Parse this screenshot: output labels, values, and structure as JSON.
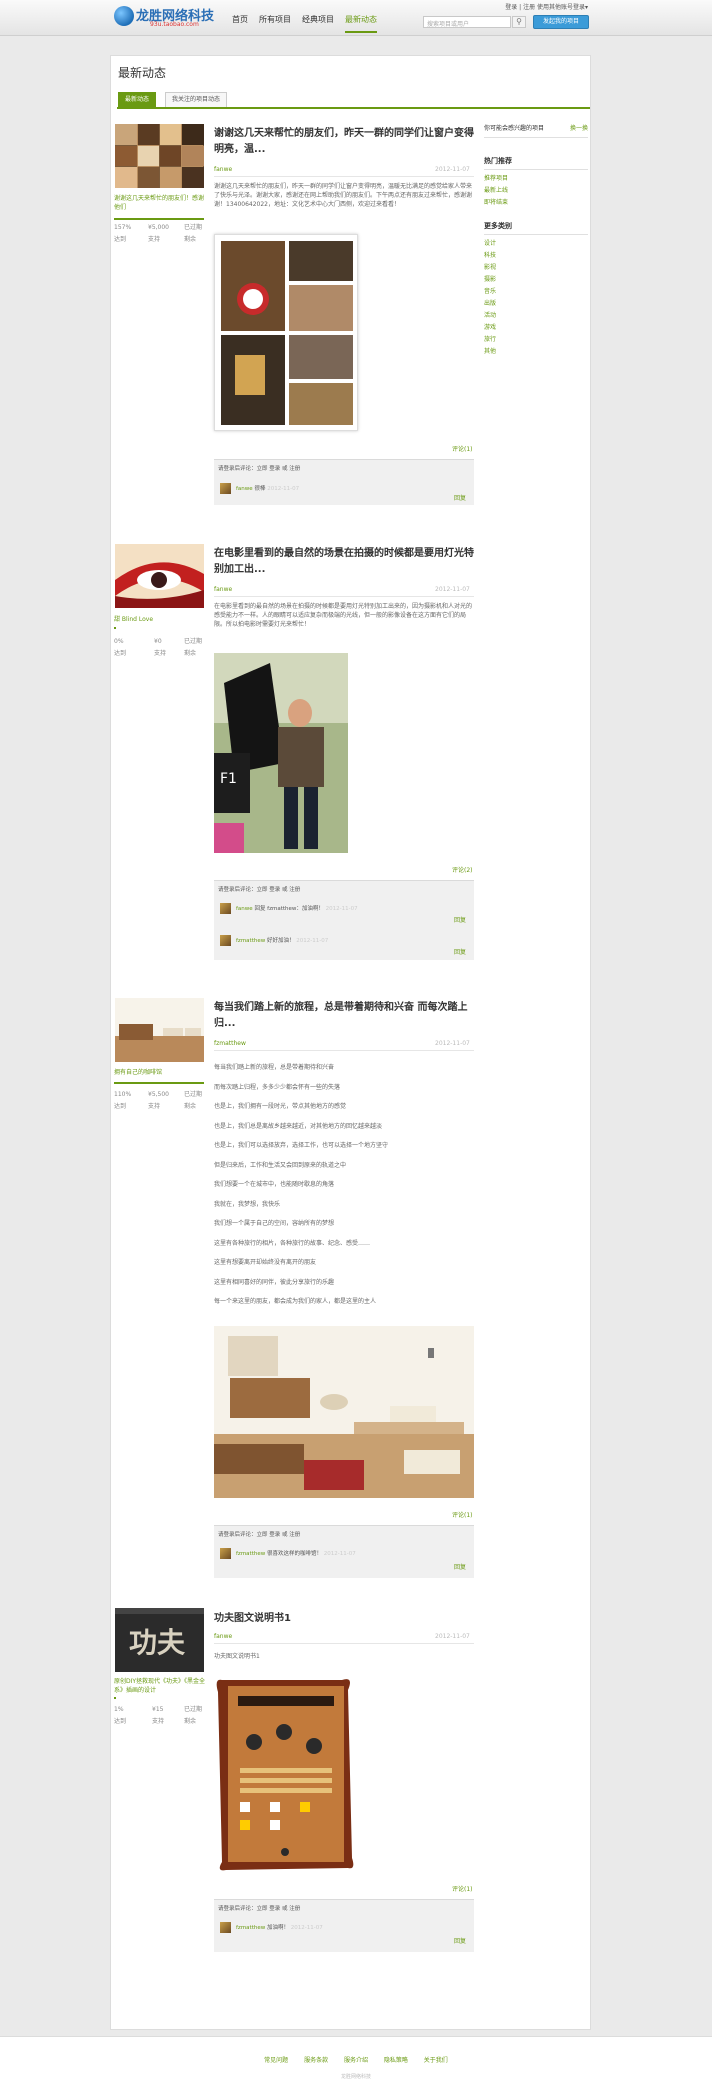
{
  "header": {
    "logo_title": "龙胜网络科技",
    "logo_sub": "93u.taobao.com",
    "nav": [
      "首页",
      "所有项目",
      "经典项目",
      "最新动态"
    ],
    "top_links": "登录 | 注册  使用其他账号登录▾",
    "search_placeholder": "搜索项目或用户",
    "create_button": "发起我的项目"
  },
  "page": {
    "title": "最新动态",
    "tabs": [
      "最新动态",
      "我关注的项目动态"
    ]
  },
  "sidebar": {
    "promo": "你可能会感兴趣的项目",
    "promo_link": "换一换",
    "hot_title": "热门推荐",
    "hot": [
      "推荐项目",
      "最新上线",
      "即将结束"
    ],
    "more_title": "更多类别",
    "more": [
      "设计",
      "科技",
      "影视",
      "摄影",
      "音乐",
      "出版",
      "活动",
      "游戏",
      "旅行",
      "其他"
    ]
  },
  "posts": [
    {
      "proj_caption": "谢谢这几天来帮忙的朋友们！感谢他们",
      "stats": [
        "157%",
        "¥5,000",
        "已过期"
      ],
      "stats_labels": [
        "达到",
        "支持",
        "剩余"
      ],
      "title": "谢谢这几天来帮忙的朋友们，昨天一群的同学们让窗户变得明亮，温...",
      "author": "fanwe",
      "date": "2012-11-07",
      "body": "谢谢这几天来帮忙的朋友们，昨天一群的同学们让窗户变得明亮，温暖无比满足的感觉给家人带来了快乐与光泽。谢谢大家，感谢还在网上帮助我们的朋友们。下午两点还有朋友过来帮忙，感谢谢谢！13400642022，地址：文化艺术中心大门西侧，欢迎过来看看！",
      "comments_link": "评论(1)",
      "login_text": "请登录后评论：立即 登录 或 注册",
      "comments": [
        {
          "user": "fanwe",
          "text": "很棒",
          "time": "2012-11-07"
        }
      ],
      "reply": "回复"
    },
    {
      "proj_caption": "甜 Blind Love",
      "stats": [
        "0%",
        "¥0",
        "已过期"
      ],
      "stats_labels": [
        "达到",
        "支持",
        "剩余"
      ],
      "title": "在电影里看到的最自然的场景在拍摄的时候都是要用灯光特别加工出...",
      "author": "fanwe",
      "date": "2012-11-07",
      "body": "在电影里看到的最自然的场景在拍摄的时候都是要用灯光特别加工出来的，因为摄影机和人对光的感受能力不一样。人的眼睛可以适应复杂而极端的光线，但一般的影像设备在这方面有它们的局限。所以拍电影时需要灯光来帮忙！",
      "comments_link": "评论(2)",
      "login_text": "请登录后评论：立即 登录 或 注册",
      "comments": [
        {
          "user": "fanwe",
          "text": "回复 fzmatthew：加油啊！",
          "time": "2012-11-07"
        },
        {
          "user": "fzmatthew",
          "text": "好好加油！",
          "time": "2012-11-07"
        }
      ],
      "reply": "回复"
    },
    {
      "proj_caption": "拥有自己的咖啡馆",
      "stats": [
        "110%",
        "¥5,500",
        "已过期"
      ],
      "stats_labels": [
        "达到",
        "支持",
        "剩余"
      ],
      "title": "每当我们踏上新的旅程，总是带着期待和兴奋 而每次踏上归...",
      "author": "fzmatthew",
      "date": "2012-11-07",
      "lines": [
        "每当我们踏上新的旅程，总是带着期待和兴奋",
        "而每次踏上归程，多多少少都会怀有一些的失落",
        "也是上，我们拥有一段时光，带点其他地方的感觉",
        "也是上，我们总是离故乡越来越近，对其他地方的回忆越来越淡",
        "也是上，我们可以选择放弃，选择工作，也可以选择一个地方坚守",
        "但是归来后，工作和生活又会回到原来的轨道之中",
        "我们想要一个在城市中，也能随时歇息的角落",
        "我就在，我梦想，我快乐",
        "",
        "我们想一个属于自己的空间，容纳所有的梦想",
        "这里有各种旅行的相片，各种旅行的故事、纪念、感受……",
        "这里有想要离开却始终没有离开的朋友",
        "这里有相同喜好的同伴，彼此分享旅行的乐趣",
        "每一个来这里的朋友，都会成为我们的家人，都是这里的主人"
      ],
      "comments_link": "评论(1)",
      "login_text": "请登录后评论：立即 登录 或 注册",
      "comments": [
        {
          "user": "fzmatthew",
          "text": "很喜欢这样的咖啡馆！",
          "time": "2012-11-07"
        }
      ],
      "reply": "回复"
    },
    {
      "proj_caption": "原创DIY拯救现代《功夫》《黑金全系》插画的设计",
      "stats": [
        "1%",
        "¥15",
        "已过期"
      ],
      "stats_labels": [
        "达到",
        "支持",
        "剩余"
      ],
      "title": "功夫图文说明书1",
      "author": "fanwe",
      "date": "2012-11-07",
      "body": "功夫图文说明书1",
      "comments_link": "评论(1)",
      "login_text": "请登录后评论：立即 登录 或 注册",
      "comments": [
        {
          "user": "fzmatthew",
          "text": "加油啊！",
          "time": "2012-11-07"
        }
      ],
      "reply": "回复"
    }
  ],
  "footer": {
    "links": "常见问题 服务条款 服务介绍 隐私策略 关于我们",
    "copyright": "龙胜网络科技"
  },
  "colors": {
    "accent": "#6a9a12",
    "brand": "#2b6fb6",
    "button": "#3b9bd8"
  }
}
